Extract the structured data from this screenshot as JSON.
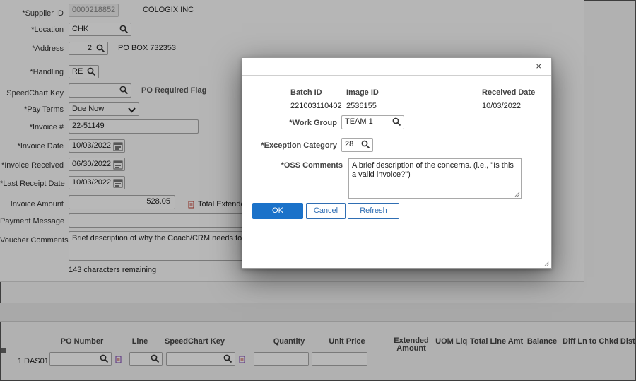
{
  "form": {
    "supplier_id_label": "*Supplier ID",
    "supplier_id": "0000218852",
    "supplier_name": "COLOGIX INC",
    "location_label": "*Location",
    "location": "CHK",
    "address_label": "*Address",
    "address_num": "2",
    "address_text": "PO BOX 732353",
    "handling_label": "*Handling",
    "handling": "RE",
    "speedchart_label": "SpeedChart Key",
    "speedchart": "",
    "po_required_flag": "PO Required Flag",
    "pay_terms_label": "*Pay Terms",
    "pay_terms": "Due Now",
    "invoice_no_label": "*Invoice #",
    "invoice_no": "22-51149",
    "invoice_date_label": "*Invoice Date",
    "invoice_date": "10/03/2022",
    "invoice_received_label": "*Invoice Received",
    "invoice_received": "06/30/2022",
    "last_receipt_label": "*Last Receipt Date",
    "last_receipt": "10/03/2022",
    "invoice_amount_label": "Invoice Amount",
    "invoice_amount": "528.05",
    "total_extended": "Total Extende",
    "payment_message_label": "Payment Message",
    "voucher_comments_label": "Voucher Comments",
    "voucher_comments": "Brief description of why the Coach/CRM needs to revie",
    "chars_remaining": "143 characters remaining"
  },
  "grid": {
    "columns": {
      "po_number": "PO Number",
      "line": "Line",
      "speedchart": "SpeedChart Key",
      "quantity": "Quantity",
      "unit_price": "Unit Price",
      "extended_amount_1": "Extended",
      "extended_amount_2": "Amount",
      "uom": "UOM",
      "liq": "Liq",
      "total_line_amt": "Total Line Amt",
      "balance": "Balance",
      "diff_ln": "Diff Ln to Chkd Dist"
    },
    "row": {
      "num": "1",
      "id": "DAS01"
    }
  },
  "modal": {
    "close": "×",
    "batch_id_label": "Batch ID",
    "batch_id": "221003110402",
    "image_id_label": "Image ID",
    "image_id": "2536155",
    "received_date_label": "Received Date",
    "received_date": "10/03/2022",
    "work_group_label": "*Work Group",
    "work_group": "TEAM 1",
    "exception_category_label": "*Exception Category",
    "exception_category": "28",
    "oss_comments_label": "*OSS Comments",
    "oss_comments": "A brief description of the concerns.  (i.e., \"Is this a valid invoice?\")",
    "ok": "OK",
    "cancel": "Cancel",
    "refresh": "Refresh"
  },
  "colors": {
    "primary_button": "#1b72c9",
    "link_blue": "#2f6eb3"
  },
  "icons": [
    "search-icon",
    "calendar-icon",
    "chevron-down-icon",
    "close-icon",
    "resize-grip-icon",
    "related-content-icon",
    "warning-icon"
  ]
}
